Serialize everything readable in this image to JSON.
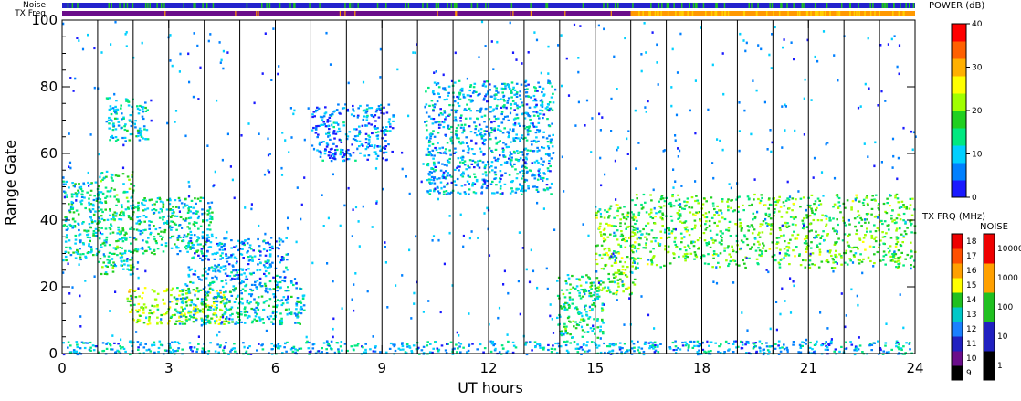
{
  "chart_data": {
    "type": "heatmap",
    "xlabel": "UT hours",
    "ylabel": "Range Gate",
    "xlim": [
      0,
      24
    ],
    "ylim": [
      0,
      100
    ],
    "x_ticks": [
      "0",
      "3",
      "6",
      "9",
      "12",
      "15",
      "18",
      "21",
      "24"
    ],
    "x_tick_values": [
      0,
      3,
      6,
      9,
      12,
      15,
      18,
      21,
      24
    ],
    "y_ticks": [
      "0",
      "20",
      "40",
      "60",
      "80",
      "100"
    ],
    "y_tick_values": [
      0,
      20,
      40,
      60,
      80,
      100
    ],
    "scan_boundaries_ut": [
      1,
      2,
      3,
      4,
      5,
      6,
      7,
      8,
      9,
      10,
      11,
      12,
      13,
      14,
      15,
      16,
      17,
      18,
      19,
      20,
      21,
      22,
      23
    ],
    "top_strips": {
      "noise_label": "Noise",
      "txfreq_label": "TX Freq",
      "noise_color": "#2222cc",
      "txfreq_segments": [
        {
          "from_ut": 0,
          "to_ut": 16,
          "color": "#6a0d8a"
        },
        {
          "from_ut": 16,
          "to_ut": 24,
          "color": "#ff9900"
        }
      ]
    },
    "echo_regions": [
      {
        "ut": [
          0,
          1.1
        ],
        "gate": [
          28,
          52
        ],
        "power": 12
      },
      {
        "ut": [
          1,
          2.0
        ],
        "gate": [
          24,
          55
        ],
        "power": 14
      },
      {
        "ut": [
          1.2,
          2.4
        ],
        "gate": [
          64,
          77
        ],
        "power": 10
      },
      {
        "ut": [
          2,
          4.2
        ],
        "gate": [
          30,
          47
        ],
        "power": 12
      },
      {
        "ut": [
          1.8,
          4.7
        ],
        "gate": [
          9,
          20
        ],
        "power": 22
      },
      {
        "ut": [
          3.2,
          6.8
        ],
        "gate": [
          9,
          22
        ],
        "power": 10
      },
      {
        "ut": [
          3.5,
          6.3
        ],
        "gate": [
          22,
          35
        ],
        "power": 6
      },
      {
        "ut": [
          7,
          9.3
        ],
        "gate": [
          58,
          75
        ],
        "power": 5
      },
      {
        "ut": [
          10.2,
          13.8
        ],
        "gate": [
          48,
          82
        ],
        "power": 8
      },
      {
        "ut": [
          13.9,
          15.2
        ],
        "gate": [
          5,
          24
        ],
        "power": 14
      },
      {
        "ut": [
          15,
          16.1
        ],
        "gate": [
          18,
          45
        ],
        "power": 20
      },
      {
        "ut": [
          16,
          24
        ],
        "gate": [
          26,
          48
        ],
        "power": 18
      },
      {
        "ut": [
          0,
          24
        ],
        "gate": [
          0,
          4
        ],
        "power": 8
      }
    ],
    "colorbars": [
      {
        "title": "POWER (dB)",
        "type": "continuous",
        "ticks": [
          "0",
          "10",
          "20",
          "30",
          "40"
        ],
        "stops": [
          "#1a1aff",
          "#0080ff",
          "#00d0ff",
          "#00e880",
          "#20d020",
          "#a0ff00",
          "#ffff00",
          "#ffb000",
          "#ff6000",
          "#ff0000"
        ]
      },
      {
        "title": "TX FRQ (MHz)",
        "type": "discrete",
        "labels": [
          "9",
          "10",
          "11",
          "12",
          "13",
          "14",
          "15",
          "16",
          "17",
          "18"
        ],
        "colors": [
          "#000000",
          "#6a0d8a",
          "#2020c0",
          "#1a80ff",
          "#00c8c8",
          "#20c020",
          "#ffff00",
          "#ffa000",
          "#ff5000",
          "#ee0000"
        ]
      },
      {
        "title": "NOISE",
        "type": "discrete",
        "labels": [
          "1",
          "10",
          "100",
          "1000",
          "10000"
        ],
        "colors": [
          "#000000",
          "#2020c0",
          "#20c020",
          "#ffa000",
          "#ee0000"
        ]
      }
    ]
  }
}
